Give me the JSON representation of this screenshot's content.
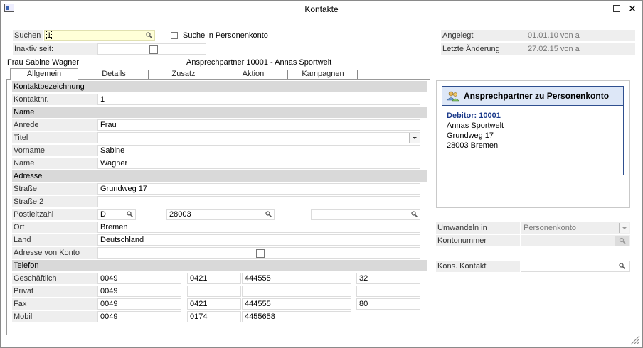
{
  "window": {
    "title": "Kontakte"
  },
  "search": {
    "label": "Suchen",
    "value": "1",
    "konto_label": "Suche in Personenkonto",
    "inaktiv_label": "Inaktiv seit:"
  },
  "meta": {
    "angelegt_label": "Angelegt",
    "angelegt_value": "01.01.10 von a",
    "aenderung_label": "Letzte Änderung",
    "aenderung_value": "27.02.15 von a"
  },
  "header": {
    "contact_name": "Frau Sabine Wagner",
    "partner": "Ansprechpartner 10001 - Annas Sportwelt"
  },
  "tabs": [
    {
      "label": "Allgemein"
    },
    {
      "label": "Details"
    },
    {
      "label": "Zusatz"
    },
    {
      "label": "Aktion"
    },
    {
      "label": "Kampagnen"
    }
  ],
  "form": {
    "sec_kontakt": "Kontaktbezeichnung",
    "kontaktnr_label": "Kontaktnr.",
    "kontaktnr": "1",
    "sec_name": "Name",
    "anrede_label": "Anrede",
    "anrede": "Frau",
    "titel_label": "Titel",
    "titel": "",
    "vorname_label": "Vorname",
    "vorname": "Sabine",
    "name_label": "Name",
    "name": "Wagner",
    "sec_adresse": "Adresse",
    "strasse_label": "Straße",
    "strasse": "Grundweg 17",
    "strasse2_label": "Straße 2",
    "strasse2": "",
    "plz_label": "Postleitzahl",
    "plz_land": "D",
    "plz": "28003",
    "plz_extra": "",
    "ort_label": "Ort",
    "ort": "Bremen",
    "land_label": "Land",
    "land": "Deutschland",
    "adr_konto_label": "Adresse von Konto",
    "sec_telefon": "Telefon",
    "phones": [
      {
        "label": "Geschäftlich",
        "c": "0049",
        "a": "0421",
        "n": "444555",
        "d": "32"
      },
      {
        "label": "Privat",
        "c": "0049",
        "a": "",
        "n": "",
        "d": ""
      },
      {
        "label": "Fax",
        "c": "0049",
        "a": "0421",
        "n": "444555",
        "d": "80"
      },
      {
        "label": "Mobil",
        "c": "0049",
        "a": "0174",
        "n": "4455658",
        "d": ""
      }
    ]
  },
  "card": {
    "title": "Ansprechpartner zu Personenkonto",
    "link": "Debitor: 10001",
    "line1": "Annas Sportwelt",
    "line2": "Grundweg 17",
    "line3": "28003 Bremen"
  },
  "right": {
    "umwandeln_label": "Umwandeln in",
    "umwandeln_value": "Personenkonto",
    "kontonummer_label": "Kontonummer",
    "kontonummer_value": "",
    "kons_label": "Kons. Kontakt",
    "kons_value": ""
  },
  "colors": {
    "field_highlight": "#ffffd8",
    "section_bg": "#d9d9d9",
    "label_bg": "#eeeeee",
    "card_border": "#2f4f8f",
    "card_head": "#dde7f7",
    "link": "#1b3a8a"
  }
}
